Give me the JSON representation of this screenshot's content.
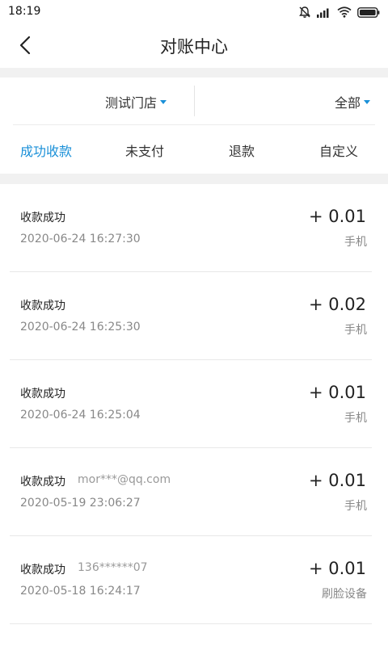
{
  "status_bar": {
    "time": "18:19",
    "icons": [
      "bell-off-icon",
      "signal-icon",
      "wifi-icon",
      "battery-icon"
    ]
  },
  "nav": {
    "title": "对账中心",
    "back_icon": "chevron-left-icon"
  },
  "filters": {
    "store": "测试门店",
    "scope": "全部",
    "accent_color": "#1a90d8"
  },
  "tabs": [
    {
      "label": "成功收款",
      "active": true
    },
    {
      "label": "未支付",
      "active": false
    },
    {
      "label": "退款",
      "active": false
    },
    {
      "label": "自定义",
      "active": false
    }
  ],
  "transactions": [
    {
      "status": "收款成功",
      "account": "",
      "time": "2020-06-24 16:27:30",
      "amount": "+ 0.01",
      "source": "手机"
    },
    {
      "status": "收款成功",
      "account": "",
      "time": "2020-06-24 16:25:30",
      "amount": "+ 0.02",
      "source": "手机"
    },
    {
      "status": "收款成功",
      "account": "",
      "time": "2020-06-24 16:25:04",
      "amount": "+ 0.01",
      "source": "手机"
    },
    {
      "status": "收款成功",
      "account": "mor***@qq.com",
      "time": "2020-05-19 23:06:27",
      "amount": "+ 0.01",
      "source": "手机"
    },
    {
      "status": "收款成功",
      "account": "136******07",
      "time": "2020-05-18 16:24:17",
      "amount": "+ 0.01",
      "source": "刷脸设备"
    }
  ]
}
